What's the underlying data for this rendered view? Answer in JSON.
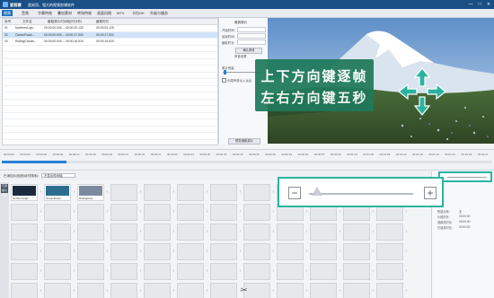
{
  "app": {
    "name": "爱剪辑",
    "subtitle": "超易用、强大的视频剪辑软件"
  },
  "window_controls": [
    "—",
    "□",
    "✕"
  ],
  "menu": {
    "items": [
      "视频",
      "音频",
      "字幕特效",
      "叠加素材",
      "转场特效",
      "画面风格",
      "MTV",
      "卡拉OK",
      "升级与服务"
    ],
    "active_index": 0
  },
  "filelist": {
    "columns": [
      "序号",
      "文件名",
      "截取原片时间段(时分秒)",
      "截取时长"
    ],
    "rows": [
      {
        "no": "01",
        "name": "NorthernLigh...",
        "range": "00:00:00.000 -- 00:00:20.125",
        "dur": "00:00:20.125",
        "selected": false
      },
      {
        "no": "02",
        "name": "OceanFlows...",
        "range": "00:00:00.000 -- 00:00:17.000",
        "dur": "00:00:17.000",
        "selected": true
      },
      {
        "no": "03",
        "name": "RollingClouds...",
        "range": "00:00:00.000 -- 00:00:16.520",
        "dur": "00:00:16.520",
        "selected": false
      }
    ]
  },
  "props": {
    "title": "裁剪原片",
    "labels": [
      "开始时间:",
      "结束时间:",
      "截取时长:"
    ],
    "section": "声音设置",
    "label_volume": "原片音量:",
    "label_headtail": "头尾声音淡入淡出",
    "btn_confirm": "确认修改",
    "btn_preview": "预览/截取原片"
  },
  "overlay": {
    "line1": "上下方向键逐帧",
    "line2": "左右方向键五秒"
  },
  "timeline": {
    "ticks": [
      "00:00:00",
      "00:00:03",
      "00:00:06",
      "00:00:09",
      "00:00:12",
      "00:00:15",
      "00:00:18",
      "00:00:21",
      "00:00:24",
      "00:00:27",
      "00:00:30",
      "00:00:33",
      "00:00:36",
      "00:00:39",
      "00:00:42",
      "00:00:45",
      "00:00:48",
      "00:00:51",
      "00:00:54",
      "00:00:57",
      "00:01:00",
      "00:01:03",
      "00:01:06",
      "00:01:09",
      "00:01:12",
      "00:01:15",
      "00:01:18",
      "00:01:21",
      "00:01:24",
      "00:01:27"
    ]
  },
  "storyboard": {
    "label": "已添加片段(拖动可排序):",
    "combo": "不显示时间轴",
    "strip_tag": "已添加片段",
    "clips": [
      "NorthernLigh...",
      "OceanFlows...",
      "RollingClou..."
    ],
    "clip_colors": [
      "#1b2a3f",
      "#2c6d8e",
      "#7c8aa0"
    ]
  },
  "info": {
    "rows": [
      {
        "label": "所选片段:",
        "value": "无"
      },
      {
        "label": "片段时长:",
        "value": "00:00:00"
      },
      {
        "label": "视频总时长:",
        "value": "00:00:00"
      },
      {
        "label": "已选总时长:",
        "value": "00:00:00"
      }
    ]
  },
  "zoom": {
    "minus": "−",
    "plus": "+",
    "level": 0.05
  },
  "colors": {
    "titlebar": "#1a4f86",
    "menu_active": "#1f6fbf",
    "highlight": "#2bb3a0",
    "overlay_bg": "#1f7a5a"
  }
}
